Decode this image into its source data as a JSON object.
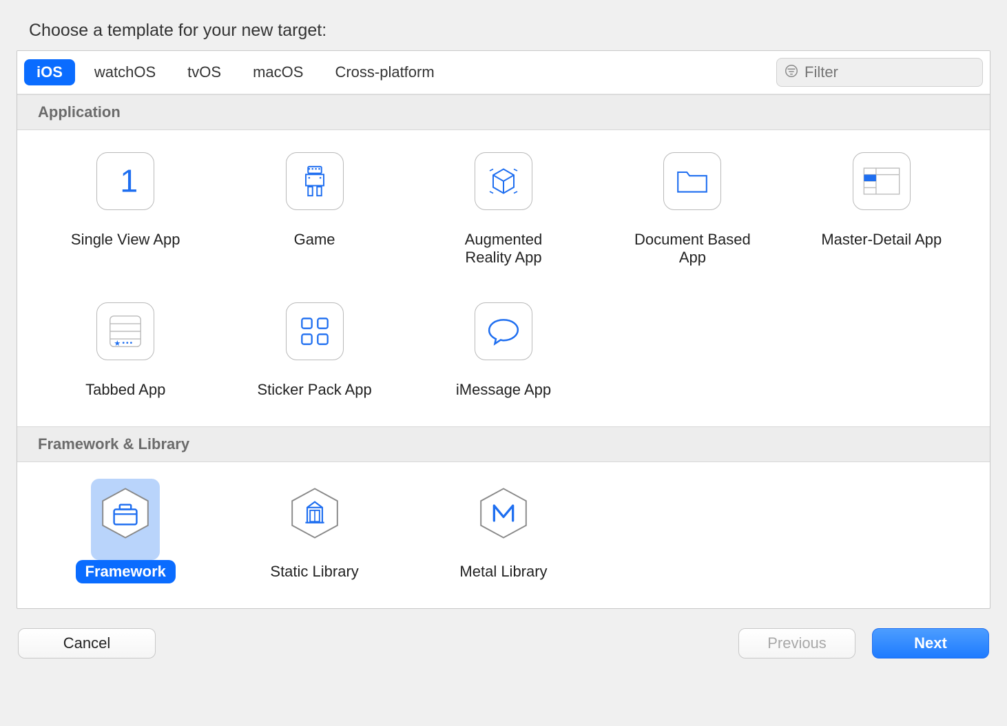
{
  "title": "Choose a template for your new target:",
  "tabs": [
    "iOS",
    "watchOS",
    "tvOS",
    "macOS",
    "Cross-platform"
  ],
  "active_tab": "iOS",
  "filter_placeholder": "Filter",
  "sections": {
    "application": {
      "header": "Application",
      "items": [
        {
          "label": "Single View App",
          "icon": "single-view-app-icon"
        },
        {
          "label": "Game",
          "icon": "game-icon"
        },
        {
          "label": "Augmented Reality App",
          "icon": "ar-app-icon"
        },
        {
          "label": "Document Based App",
          "icon": "document-app-icon"
        },
        {
          "label": "Master-Detail App",
          "icon": "master-detail-app-icon"
        },
        {
          "label": "Tabbed App",
          "icon": "tabbed-app-icon"
        },
        {
          "label": "Sticker Pack App",
          "icon": "sticker-pack-icon"
        },
        {
          "label": "iMessage App",
          "icon": "imessage-app-icon"
        }
      ]
    },
    "framework": {
      "header": "Framework & Library",
      "items": [
        {
          "label": "Framework",
          "icon": "framework-icon",
          "selected": true
        },
        {
          "label": "Static Library",
          "icon": "static-library-icon"
        },
        {
          "label": "Metal Library",
          "icon": "metal-library-icon"
        }
      ]
    }
  },
  "buttons": {
    "cancel": "Cancel",
    "previous": "Previous",
    "next": "Next"
  },
  "colors": {
    "accent": "#0a6cff",
    "selection_bg": "#b9d4fb"
  }
}
